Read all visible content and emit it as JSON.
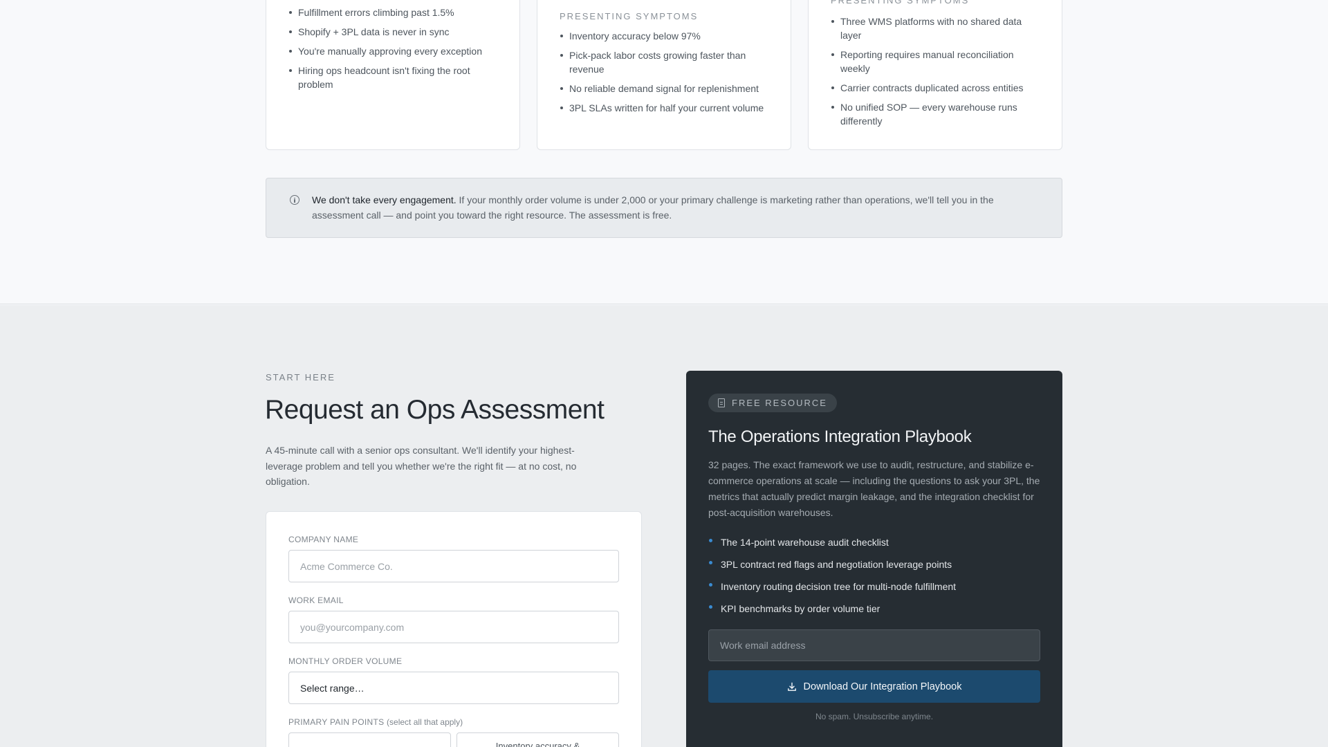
{
  "cards": [
    {
      "eyebrow": "",
      "items": [
        "Fulfillment errors climbing past 1.5%",
        "Shopify + 3PL data is never in sync",
        "You're manually approving every exception",
        "Hiring ops headcount isn't fixing the root problem"
      ]
    },
    {
      "eyebrow": "PRESENTING SYMPTOMS",
      "items": [
        "Inventory accuracy below 97%",
        "Pick-pack labor costs growing faster than revenue",
        "No reliable demand signal for replenishment",
        "3PL SLAs written for half your current volume"
      ]
    },
    {
      "eyebrow": "PRESENTING SYMPTOMS",
      "items": [
        "Three WMS platforms with no shared data layer",
        "Reporting requires manual reconciliation weekly",
        "Carrier contracts duplicated across entities",
        "No unified SOP — every warehouse runs differently"
      ]
    }
  ],
  "notice": {
    "icon": "info-icon",
    "strong": "We don't take every engagement.",
    "text": " If your monthly order volume is under 2,000 or your primary challenge is marketing rather than operations, we'll tell you in the assessment call — and point you toward the right resource. The assessment is free."
  },
  "assessment": {
    "eyebrow": "START HERE",
    "title": "Request an Ops Assessment",
    "lead": "A 45-minute call with a senior ops consultant. We'll identify your highest-leverage problem and tell you whether we're the right fit — at no cost, no obligation."
  },
  "form": {
    "company_label": "COMPANY NAME",
    "company_placeholder": "Acme Commerce Co.",
    "email_label": "WORK EMAIL",
    "email_placeholder": "you@yourcompany.com",
    "volume_label": "MONTHLY ORDER VOLUME",
    "volume_value": "Select range…",
    "pain_label": "PRIMARY PAIN POINTS",
    "pain_hint": "(select all that apply)",
    "chips": [
      "",
      "Inventory accuracy &"
    ]
  },
  "resource": {
    "badge": "FREE RESOURCE",
    "badge_icon": "document-icon",
    "title": "The Operations Integration Playbook",
    "description": "32 pages. The exact framework we use to audit, restructure, and stabilize e-commerce operations at scale — including the questions to ask your 3PL, the metrics that actually predict margin leakage, and the integration checklist for post-acquisition warehouses.",
    "items": [
      "The 14-point warehouse audit checklist",
      "3PL contract red flags and negotiation leverage points",
      "Inventory routing decision tree for multi-node fulfillment",
      "KPI benchmarks by order volume tier"
    ],
    "email_placeholder": "Work email address",
    "button_label": "Download Our Integration Playbook",
    "button_icon": "download-icon",
    "note": "No spam. Unsubscribe anytime."
  },
  "colors": {
    "accent": "#3a8bd1",
    "button": "#1c4a6e",
    "dark_panel": "#262d33"
  }
}
